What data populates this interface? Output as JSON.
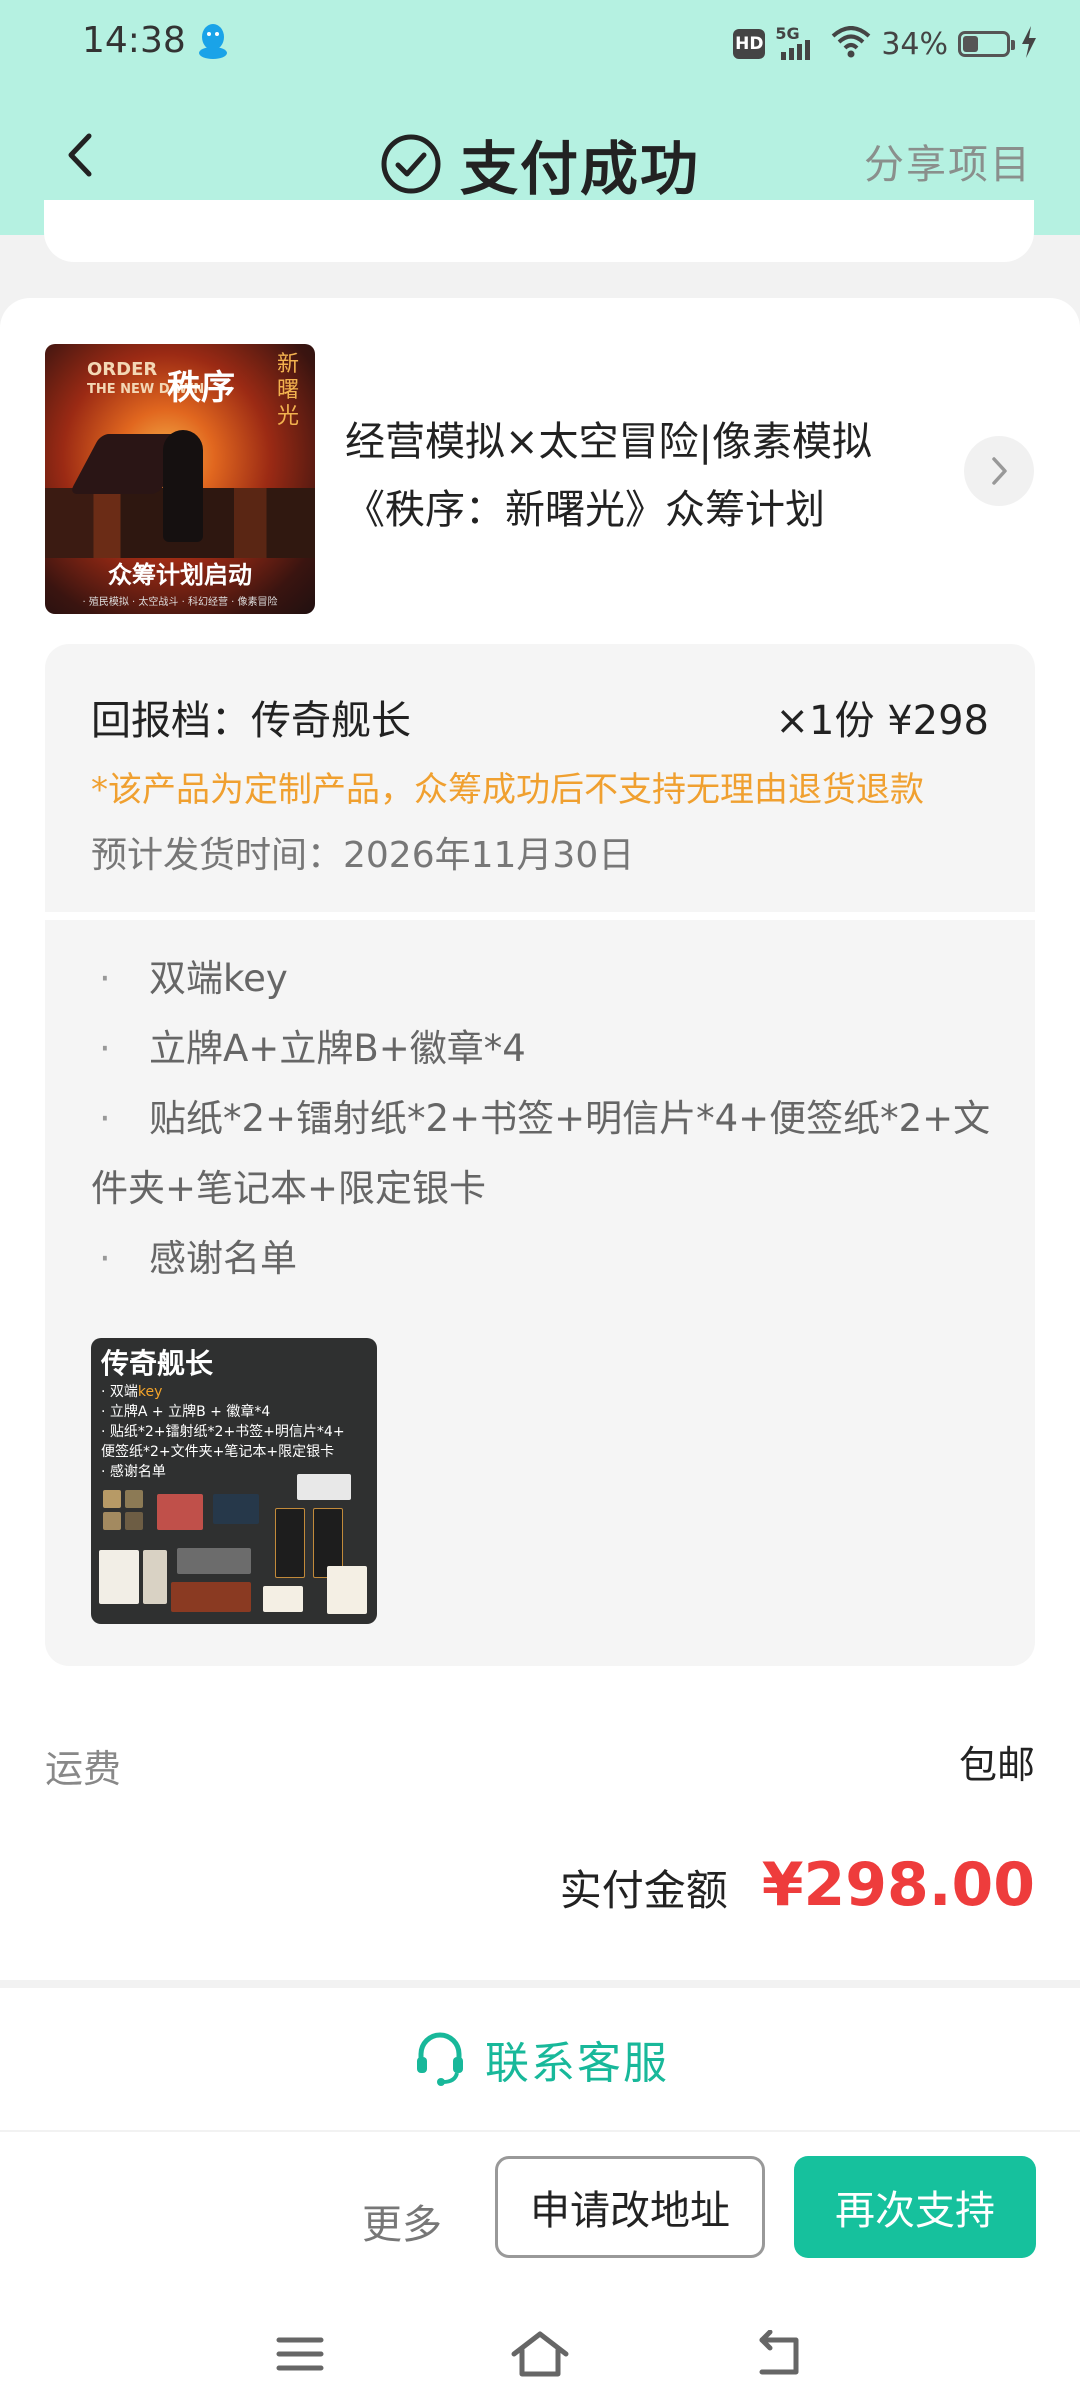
{
  "status_bar": {
    "time": "14:38",
    "hd": "HD",
    "network": "5G",
    "battery": "34%"
  },
  "header": {
    "title": "支付成功",
    "share": "分享项目"
  },
  "project": {
    "title_line1": "经营模拟×太空冒险|像素模拟",
    "title_line2": "《秩序：新曙光》众筹计划",
    "cover": {
      "order_text_1": "ORDER",
      "order_text_2": "THE NEW DAWN",
      "title": "秩序",
      "side_text": "新曙光",
      "launch_text": "众筹计划启动",
      "tags": "· 殖民模拟 · 太空战斗 · 科幻经营 · 像素冒险"
    }
  },
  "tier": {
    "name": "回报档：传奇舰长",
    "quantity_price": "×1份 ¥298",
    "warning": "*该产品为定制产品，众筹成功后不支持无理由退货退款",
    "ship_date": "预计发货时间：2026年11月30日"
  },
  "items": [
    "双端key",
    "立牌A+立牌B+徽章*4",
    "贴纸*2+镭射纸*2+书签+明信片*4+便签纸*2+文件夹+笔记本+限定银卡",
    "感谢名单"
  ],
  "reward_image": {
    "title": "传奇舰长",
    "line1_a": "· 双端",
    "line1_b": "key",
    "line2": "· 立牌A + 立牌B + 徽章*4",
    "line3": "· 贴纸*2+镭射纸*2+书签+明信片*4+",
    "line4": "便签纸*2+文件夹+笔记本+限定银卡",
    "line5": "· 感谢名单"
  },
  "shipping": {
    "label": "运费",
    "value": "包邮"
  },
  "payment": {
    "label": "实付金额",
    "amount": "¥298.00"
  },
  "service": {
    "label": "联系客服"
  },
  "actions": {
    "more": "更多",
    "change_address": "申请改地址",
    "support_again": "再次支持"
  },
  "colors": {
    "header_bg": "#b5f1e1",
    "accent": "#16c19d",
    "price_red": "#ee3c3c",
    "warning_orange": "#f0a030"
  }
}
